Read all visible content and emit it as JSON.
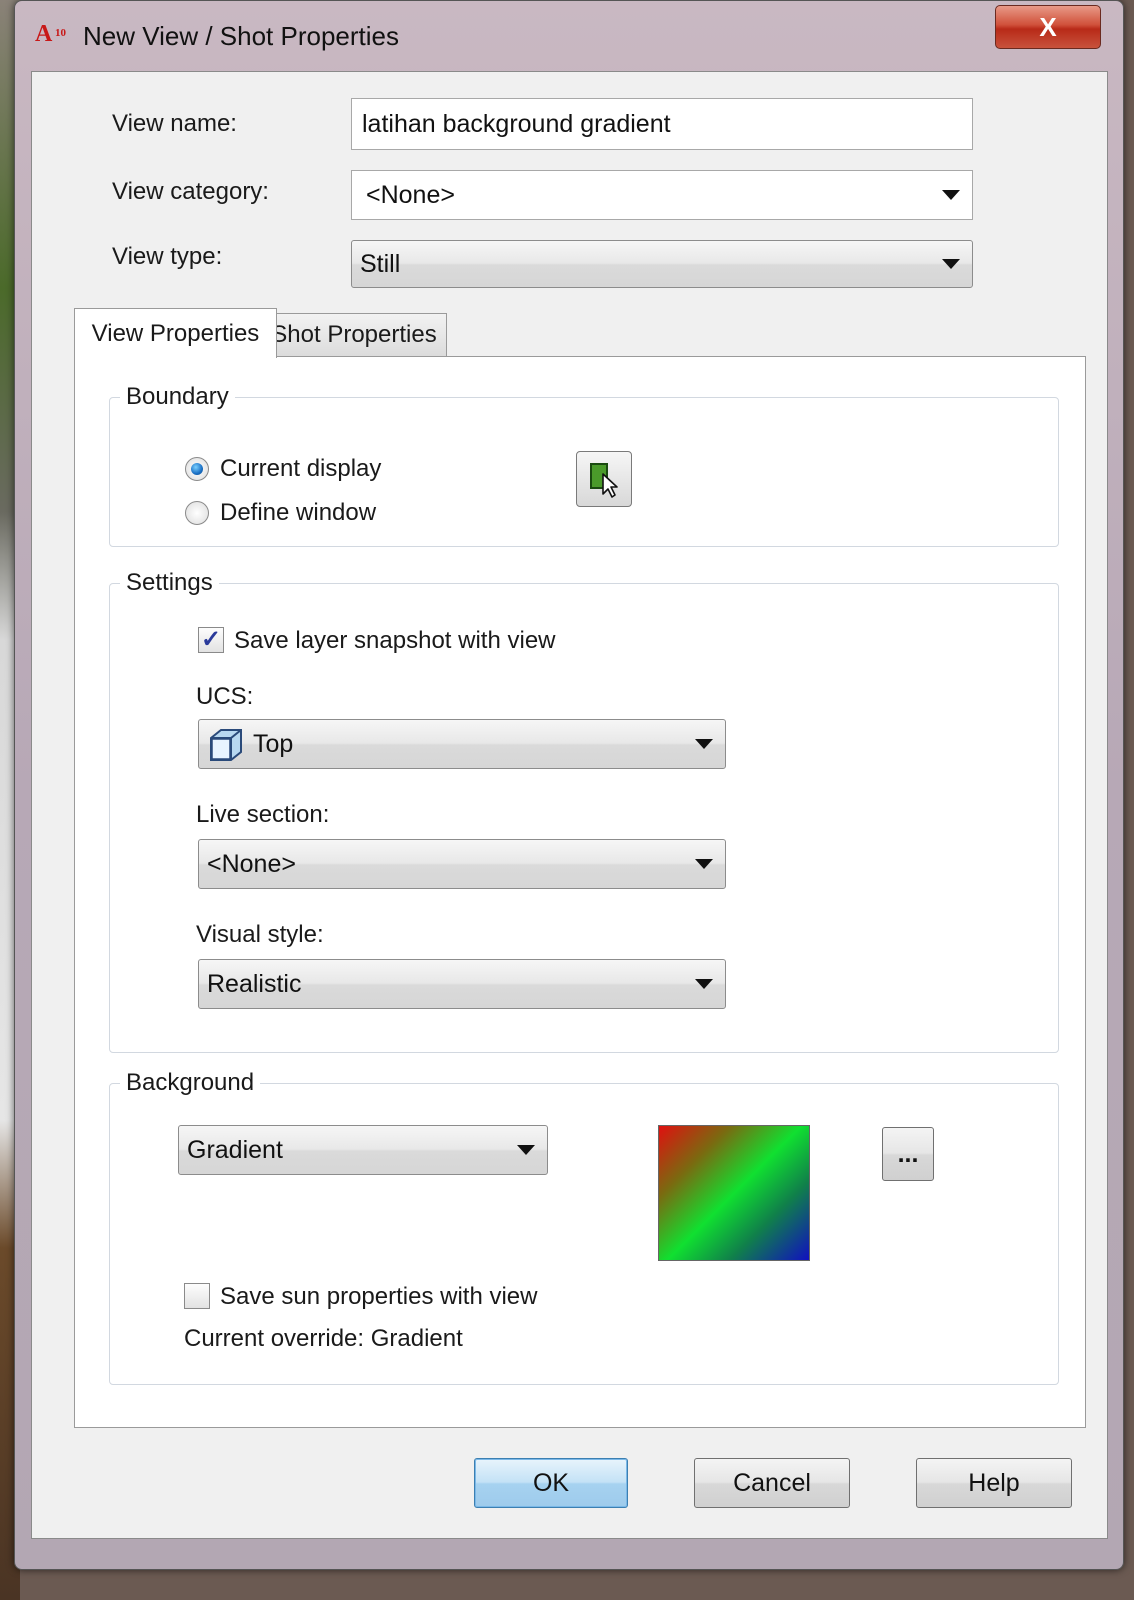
{
  "window": {
    "title": "New View / Shot Properties",
    "app_icon": "autocad-a-icon",
    "app_icon_text": "A",
    "app_icon_badge": "10",
    "close_label": "X"
  },
  "fields": {
    "view_name_label": "View name:",
    "view_name_value": "latihan background gradient",
    "view_category_label": "View category:",
    "view_category_value": "<None>",
    "view_type_label": "View type:",
    "view_type_value": "Still"
  },
  "tabs": [
    {
      "label": "View Properties",
      "active": true
    },
    {
      "label": "Shot Properties",
      "active": false
    }
  ],
  "boundary": {
    "legend": "Boundary",
    "options": [
      {
        "label": "Current display",
        "selected": true
      },
      {
        "label": "Define window",
        "selected": false
      }
    ],
    "pick_icon": "define-window-pick-icon"
  },
  "settings": {
    "legend": "Settings",
    "save_layer_label": "Save layer snapshot with view",
    "save_layer_checked": true,
    "ucs_label": "UCS:",
    "ucs_value": "Top",
    "ucs_icon": "ucs-cube-icon",
    "live_section_label": "Live section:",
    "live_section_value": "<None>",
    "visual_style_label": "Visual style:",
    "visual_style_value": "Realistic"
  },
  "background": {
    "legend": "Background",
    "type_value": "Gradient",
    "swatch_colors": [
      "#e01010",
      "#10e030",
      "#1010c0"
    ],
    "browse_label": "...",
    "save_sun_label": "Save sun properties with view",
    "save_sun_checked": false,
    "current_override_label": "Current override: Gradient"
  },
  "buttons": {
    "ok": "OK",
    "cancel": "Cancel",
    "help": "Help"
  }
}
